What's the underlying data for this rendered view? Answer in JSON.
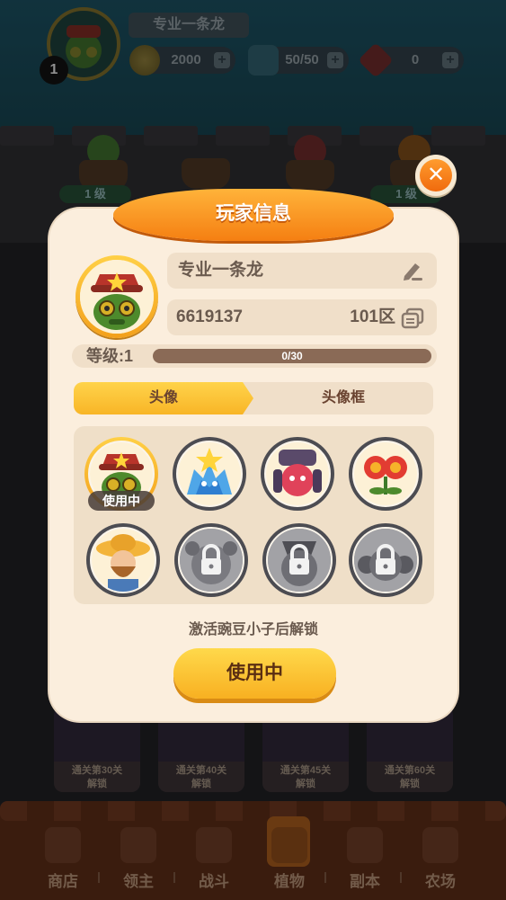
{
  "top_bar": {
    "player_name": "专业一条龙",
    "level_badge": "1",
    "gold": "2000",
    "energy": "50/50",
    "gems": "0"
  },
  "plants_row": {
    "levels": [
      "1 级",
      "1 级"
    ]
  },
  "locked_cards": [
    {
      "line1": "通关第30关",
      "line2": "解锁"
    },
    {
      "line1": "通关第40关",
      "line2": "解锁"
    },
    {
      "line1": "通关第45关",
      "line2": "解锁"
    },
    {
      "line1": "通关第60关",
      "line2": "解锁"
    }
  ],
  "bottom_nav": {
    "items": [
      {
        "label": "商店"
      },
      {
        "label": "领主"
      },
      {
        "label": "战斗"
      },
      {
        "label": "植物"
      },
      {
        "label": "副本"
      },
      {
        "label": "农场"
      }
    ]
  },
  "modal": {
    "title": "玩家信息",
    "player_name": "专业一条龙",
    "player_id": "6619137",
    "server": "101区",
    "level_label": "等级:1",
    "exp_text": "0/30",
    "exp_progress": 0,
    "tabs": [
      {
        "label": "头像"
      },
      {
        "label": "头像框"
      }
    ],
    "in_use_badge": "使用中",
    "unlock_hint": "激活豌豆小子后解锁",
    "action_button": "使用中"
  },
  "colors": {
    "accent_orange": "#f57f12",
    "accent_yellow": "#f8b527",
    "panel_bg": "#fbeedd",
    "text_brown": "#6a5a4e"
  },
  "icons": [
    "edit-icon",
    "copy-icon",
    "close-icon",
    "lock-icon",
    "coin-icon",
    "energy-icon",
    "gem-icon",
    "plus-icon"
  ]
}
